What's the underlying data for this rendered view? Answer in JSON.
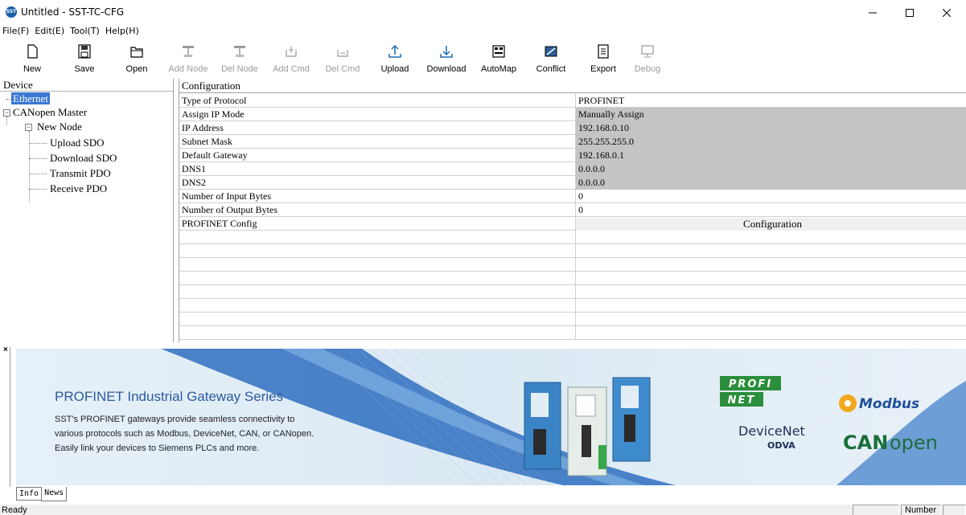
{
  "window": {
    "title": "Untitled - SST-TC-CFG",
    "app_icon_text": "SST",
    "controls": [
      "minimize",
      "maximize",
      "close"
    ]
  },
  "menu": [
    "File(F)",
    "Edit(E)",
    "Tool(T)",
    "Help(H)"
  ],
  "toolbar": [
    {
      "label": "New",
      "icon": "new-file-icon",
      "enabled": true
    },
    {
      "label": "Save",
      "icon": "save-icon",
      "enabled": true
    },
    {
      "label": "Open",
      "icon": "open-folder-icon",
      "enabled": true
    },
    {
      "label": "Add Node",
      "icon": "add-node-icon",
      "enabled": false
    },
    {
      "label": "Del Node",
      "icon": "delete-node-icon",
      "enabled": false
    },
    {
      "label": "Add Cmd",
      "icon": "add-cmd-icon",
      "enabled": false
    },
    {
      "label": "Del Cmd",
      "icon": "delete-cmd-icon",
      "enabled": false
    },
    {
      "label": "Upload",
      "icon": "upload-icon",
      "enabled": true
    },
    {
      "label": "Download",
      "icon": "download-icon",
      "enabled": true
    },
    {
      "label": "AutoMap",
      "icon": "automap-icon",
      "enabled": true
    },
    {
      "label": "Conflict",
      "icon": "conflict-icon",
      "enabled": true
    },
    {
      "label": "Export",
      "icon": "export-icon",
      "enabled": true
    },
    {
      "label": "Debug",
      "icon": "debug-icon",
      "enabled": false
    }
  ],
  "device_panel": {
    "header": "Device",
    "tree": [
      {
        "label": "Ethernet",
        "selected": true
      },
      {
        "label": "CANopen Master",
        "expander": "−"
      },
      {
        "label": "New Node",
        "expander": "−"
      },
      {
        "label": "Upload SDO"
      },
      {
        "label": "Download SDO"
      },
      {
        "label": "Transmit PDO"
      },
      {
        "label": "Receive PDO"
      }
    ]
  },
  "config": {
    "header": "Configuration",
    "rows": [
      {
        "name": "Type of Protocol",
        "value": "PROFINET"
      },
      {
        "name": "Assign IP Mode",
        "value": "Manually Assign"
      },
      {
        "name": "IP Address",
        "value": "192.168.0.10"
      },
      {
        "name": "Subnet Mask",
        "value": "255.255.255.0"
      },
      {
        "name": "Default Gateway",
        "value": "192.168.0.1"
      },
      {
        "name": "DNS1",
        "value": "0.0.0.0"
      },
      {
        "name": "DNS2",
        "value": "0.0.0.0"
      },
      {
        "name": "Number of Input Bytes",
        "value": "0"
      },
      {
        "name": "Number of Output Bytes",
        "value": "0"
      },
      {
        "name": "PROFINET Config",
        "value": "Configuration"
      }
    ]
  },
  "banner": {
    "close": "×",
    "title": "PROFINET Industrial Gateway Series",
    "lines": [
      "SST's PROFINET gateways provide seamless connectivity to",
      "various protocols such as Modbus, DeviceNet, CAN, or CANopen.",
      "Easily link your devices to Siemens PLCs and more."
    ],
    "logos": {
      "profinet": [
        "PROFI",
        "NET"
      ],
      "modbus": "Modbus",
      "devicenet": [
        "DeviceNet",
        "ODVA"
      ],
      "canopen": [
        "CAN",
        "open"
      ]
    },
    "accent": "#2a5aa0"
  },
  "tabs": [
    {
      "label": "Info",
      "active": false
    },
    {
      "label": "News",
      "active": true
    }
  ],
  "status": {
    "text": "Ready",
    "indicator": "Number"
  },
  "colors": {
    "selection": "#3a78d4",
    "shaded_cell": "#c4c4c4",
    "banner_bg": "#dbeaf5"
  }
}
